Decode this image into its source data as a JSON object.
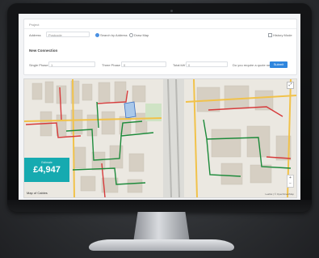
{
  "app": {
    "topbar_label": "Project"
  },
  "form": {
    "address_label": "Address",
    "address_value": "Postcode",
    "radio1_label": "Search by Address",
    "radio2_label": "Draw Map",
    "history_label": "History Mode",
    "section_title": "New Connection",
    "single_phase_label": "Single Phase",
    "single_phase_value": "1",
    "three_phase_label": "Three Phase",
    "three_phase_value": "0",
    "total_kw_label": "Total kW",
    "total_kw_value": "0",
    "question_label": "Do you require a quote next?",
    "submit_label": "Submit"
  },
  "map": {
    "price_label": "Estimate",
    "price_value": "£4,947",
    "logo_text": "Map of Cables",
    "credit_text": "Leaflet | © OpenStreetMap",
    "zoom_in": "+",
    "zoom_out": "−",
    "expand": "⤢"
  },
  "colors": {
    "accent": "#16aab0",
    "button": "#2f86de",
    "cable_red": "#d63b3b",
    "cable_green": "#1c8a3a",
    "road_yellow": "#f1c24a"
  }
}
